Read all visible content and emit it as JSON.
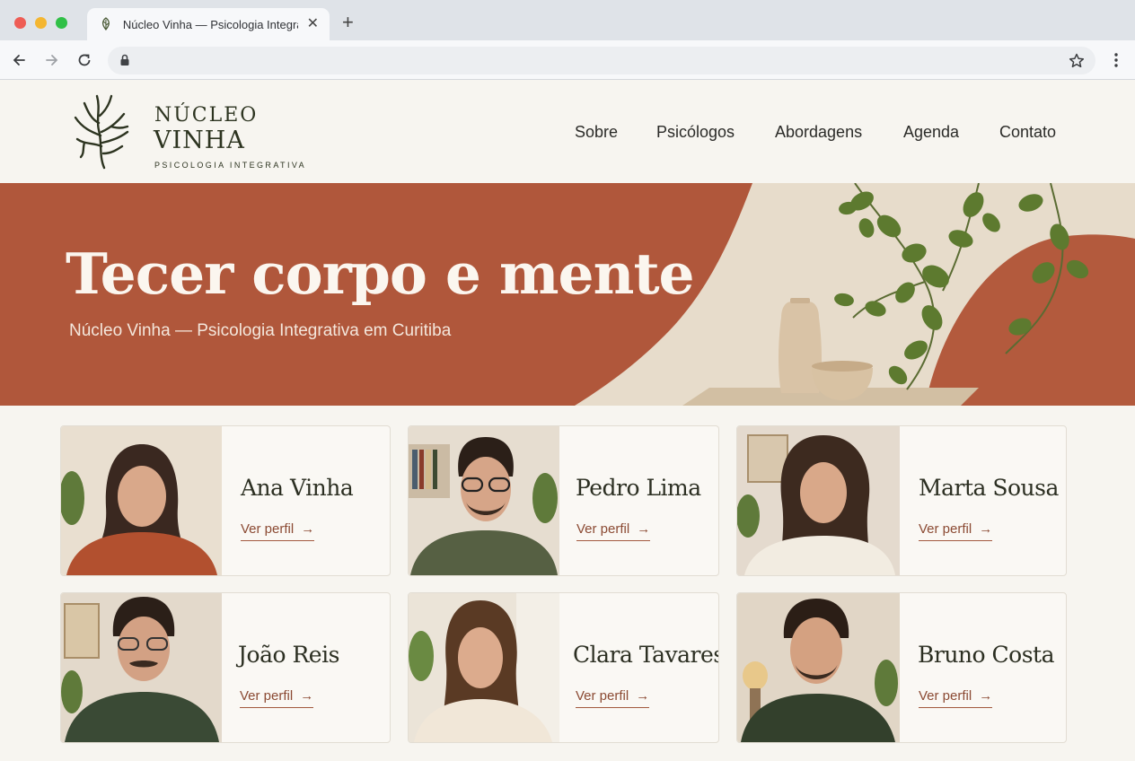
{
  "browser": {
    "tab_title": "Núcleo Vinha — Psicologia Integrativa",
    "url": ""
  },
  "header": {
    "logo_line1": "NÚCLEO",
    "logo_line2": "VINHA",
    "logo_tagline": "PSICOLOGIA INTEGRATIVA",
    "nav": [
      "Sobre",
      "Psicólogos",
      "Abordagens",
      "Agenda",
      "Contato"
    ]
  },
  "hero": {
    "title": "Tecer corpo e mente",
    "subtitle": "Núcleo Vinha — Psicologia Integrativa em Curitiba"
  },
  "psychologists": [
    {
      "name": "Ana Vinha",
      "link": "Ver perfil",
      "arrow": "→"
    },
    {
      "name": "Pedro Lima",
      "link": "Ver perfil",
      "arrow": "→"
    },
    {
      "name": "Marta Sousa",
      "link": "Ver perfil",
      "arrow": "→"
    },
    {
      "name": "João Reis",
      "link": "Ver perfil",
      "arrow": "→"
    },
    {
      "name": "Clara Tavares",
      "link": "Ver perfil",
      "arrow": "→"
    },
    {
      "name": "Bruno Costa",
      "link": "Ver perfil",
      "arrow": "→"
    }
  ],
  "colors": {
    "terracotta": "#b0573b",
    "olive": "#2d3420",
    "link": "#8b4a33",
    "background": "#f7f5f0"
  }
}
